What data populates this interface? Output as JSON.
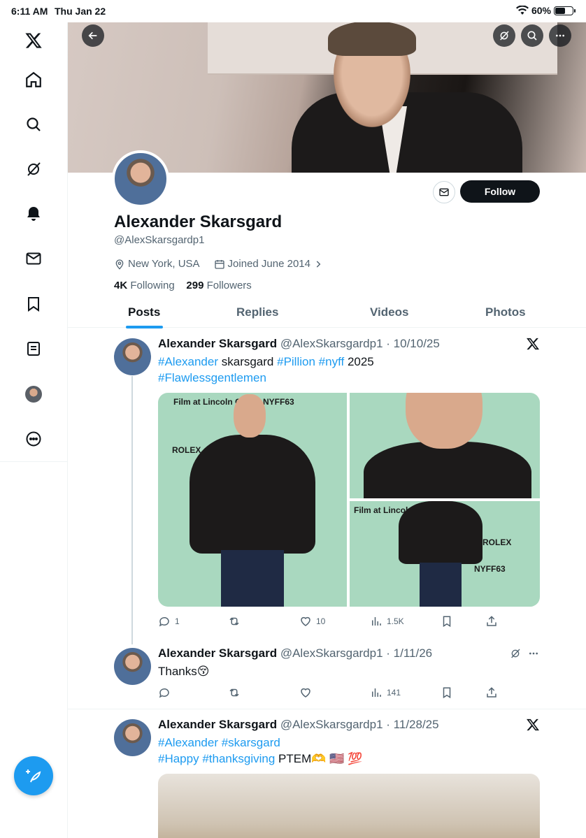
{
  "status_bar": {
    "time": "6:11 AM",
    "date": "Thu Jan 22",
    "battery": "60%",
    "battery_level": 0.6
  },
  "sidebar": {
    "items": [
      {
        "icon": "x-logo-icon"
      },
      {
        "icon": "home-icon"
      },
      {
        "icon": "search-icon"
      },
      {
        "icon": "grok-icon"
      },
      {
        "icon": "notifications-icon"
      },
      {
        "icon": "messages-icon"
      },
      {
        "icon": "bookmarks-icon"
      },
      {
        "icon": "lists-icon"
      },
      {
        "icon": "profile-avatar"
      },
      {
        "icon": "more-icon"
      }
    ],
    "compose_icon": "compose-icon"
  },
  "profile": {
    "name": "Alexander Skarsgard",
    "handle": "@AlexSkarsgardp1",
    "location": "New York, USA",
    "joined": "Joined June 2014",
    "following_count": "4K",
    "following_label": "Following",
    "followers_count": "299",
    "followers_label": "Followers",
    "follow_label": "Follow"
  },
  "tabs": [
    "Posts",
    "Replies",
    "Videos",
    "Photos"
  ],
  "active_tab": "Posts",
  "tweets": [
    {
      "name": "Alexander Skarsgard",
      "handle": "@AlexSkarsgardp1",
      "date": "· 10/10/25",
      "text": [
        {
          "t": "#Alexander",
          "tag": true
        },
        {
          "t": " skarsgard ",
          "tag": false
        },
        {
          "t": "#Pillion",
          "tag": true
        },
        {
          "t": " ",
          "tag": false
        },
        {
          "t": "#nyff",
          "tag": true
        },
        {
          "t": " 2025",
          "tag": false
        }
      ],
      "text_line2": "#Flawlessgentlemen",
      "media_logos": [
        "Film at Lincoln Center",
        "NYFF63",
        "ROLEX"
      ],
      "replies": "1",
      "reposts": "",
      "likes": "10",
      "views": "1.5K"
    },
    {
      "name": "Alexander Skarsgard",
      "handle": "@AlexSkarsgardp1",
      "date": "· 1/11/26",
      "text_plain": "Thanks😚",
      "replies": "",
      "reposts": "",
      "likes": "",
      "views": "141"
    },
    {
      "name": "Alexander Skarsgard",
      "handle": "@AlexSkarsgardp1",
      "date": "· 11/28/25",
      "line1": "#Alexander #skarsgard",
      "line2_tags": "#Happy #thanksgiving",
      "line2_rest": " PTEM🫶 🇺🇸 💯"
    }
  ]
}
